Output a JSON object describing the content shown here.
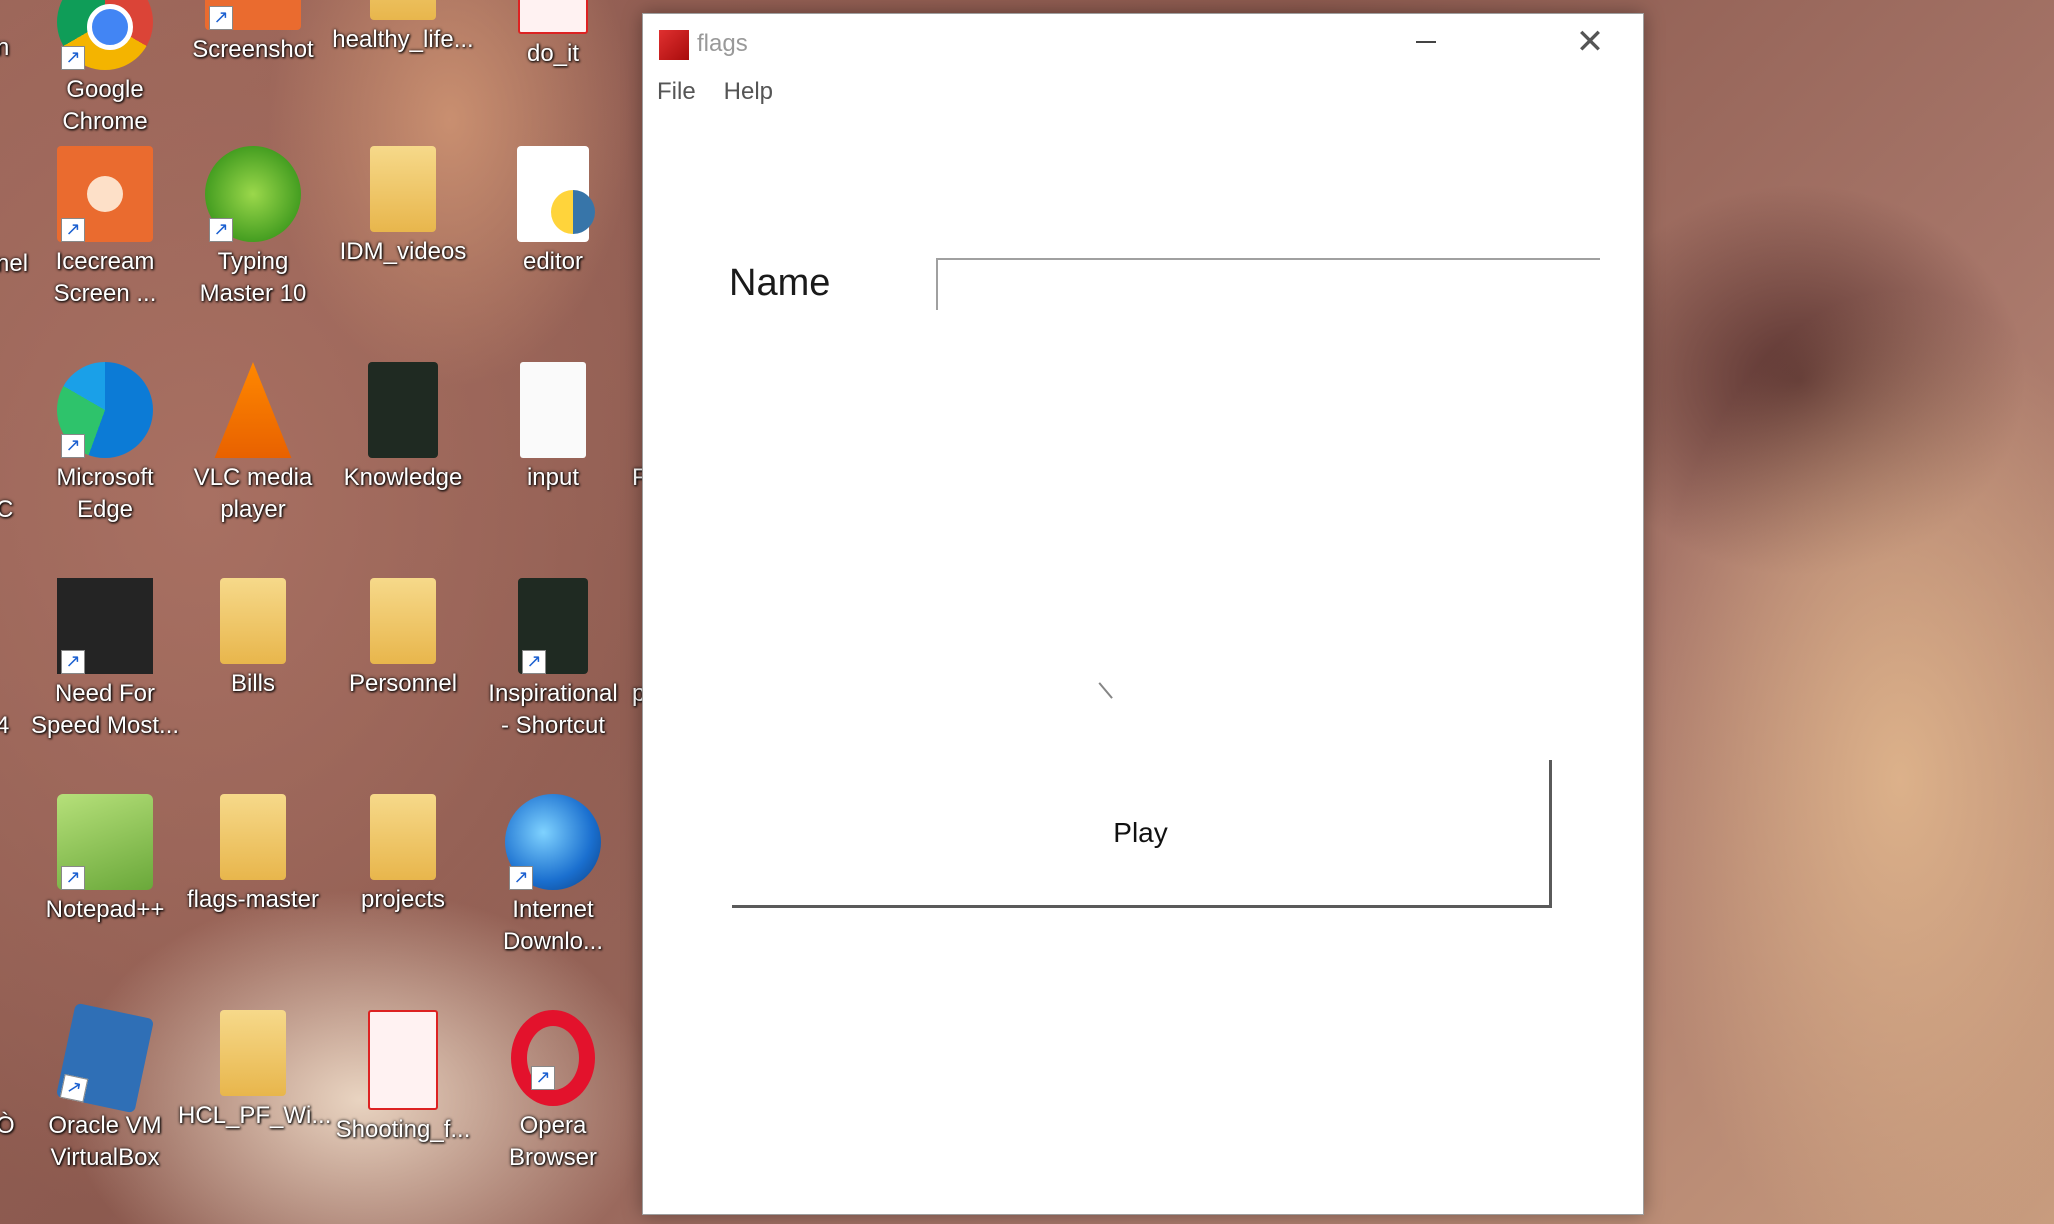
{
  "desktop": {
    "icons": [
      {
        "label": "Google\nChrome",
        "icon": "chrome-icon"
      },
      {
        "label": "Screenshot",
        "icon": "folder-icon"
      },
      {
        "label": "healthy_life...",
        "icon": "folder-icon"
      },
      {
        "label": "do_it",
        "icon": "pdf-icon"
      },
      {
        "label": "Icecream\nScreen ...",
        "icon": "icecream-icon"
      },
      {
        "label": "Typing\nMaster 10",
        "icon": "typing-master-icon"
      },
      {
        "label": "IDM_videos",
        "icon": "folder-icon"
      },
      {
        "label": "editor",
        "icon": "python-file-icon"
      },
      {
        "label": "Microsoft\nEdge",
        "icon": "edge-icon"
      },
      {
        "label": "VLC media\nplayer",
        "icon": "vlc-icon"
      },
      {
        "label": "Knowledge",
        "icon": "folder-icon"
      },
      {
        "label": "input",
        "icon": "text-file-icon"
      },
      {
        "label": "Need For\nSpeed Most...",
        "icon": "nfs-icon"
      },
      {
        "label": "Bills",
        "icon": "folder-icon"
      },
      {
        "label": "Personnel",
        "icon": "folder-icon"
      },
      {
        "label": "Inspirational\n- Shortcut",
        "icon": "folder-shortcut-icon"
      },
      {
        "label": "Notepad++",
        "icon": "notepadpp-icon"
      },
      {
        "label": "flags-master",
        "icon": "folder-icon"
      },
      {
        "label": "projects",
        "icon": "folder-icon"
      },
      {
        "label": "Internet\nDownlo...",
        "icon": "idm-icon"
      },
      {
        "label": "Oracle VM\nVirtualBox",
        "icon": "virtualbox-icon"
      },
      {
        "label": "HCL_PF_Wi...",
        "icon": "folder-icon"
      },
      {
        "label": "Shooting_f...",
        "icon": "folder-icon"
      },
      {
        "label": "Opera\nBrowser",
        "icon": "opera-icon"
      }
    ],
    "edge_fragments": [
      "n",
      "nel",
      "C",
      "4",
      "Ò",
      "F",
      "p"
    ]
  },
  "window": {
    "title": "flags",
    "menu": [
      "File",
      "Help"
    ],
    "name_label": "Name",
    "name_value": "",
    "play_label": "Play"
  }
}
